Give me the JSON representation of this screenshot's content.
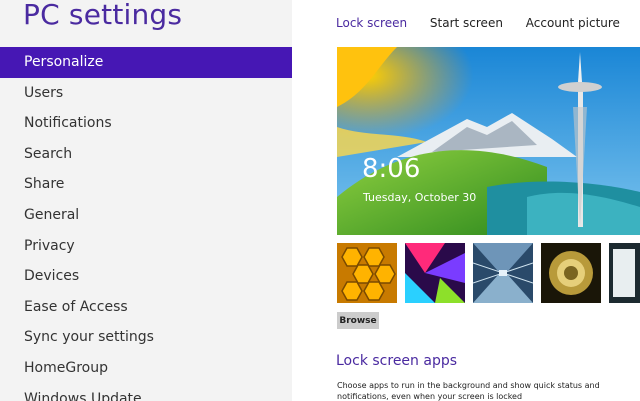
{
  "app": {
    "title": "PC settings"
  },
  "sidebar": {
    "items": [
      {
        "label": "Personalize",
        "active": true
      },
      {
        "label": "Users"
      },
      {
        "label": "Notifications"
      },
      {
        "label": "Search"
      },
      {
        "label": "Share"
      },
      {
        "label": "General"
      },
      {
        "label": "Privacy"
      },
      {
        "label": "Devices"
      },
      {
        "label": "Ease of Access"
      },
      {
        "label": "Sync your settings"
      },
      {
        "label": "HomeGroup"
      },
      {
        "label": "Windows Update"
      }
    ]
  },
  "tabs": [
    {
      "label": "Lock screen",
      "active": true
    },
    {
      "label": "Start screen"
    },
    {
      "label": "Account picture"
    }
  ],
  "lock_preview": {
    "time": "8:06",
    "date": "Tuesday, October 30"
  },
  "thumbnails": [
    {
      "icon": "honeycomb-image"
    },
    {
      "icon": "abstract-shapes-image"
    },
    {
      "icon": "tunnel-image"
    },
    {
      "icon": "nautilus-shell-image"
    },
    {
      "icon": "partial-image"
    }
  ],
  "browse_button": {
    "label": "Browse"
  },
  "lock_apps": {
    "title": "Lock screen apps",
    "description": "Choose apps to run in the background and show quick status and notifications, even when your screen is locked"
  },
  "colors": {
    "accent": "#4617b4",
    "title": "#4a2aa0"
  }
}
